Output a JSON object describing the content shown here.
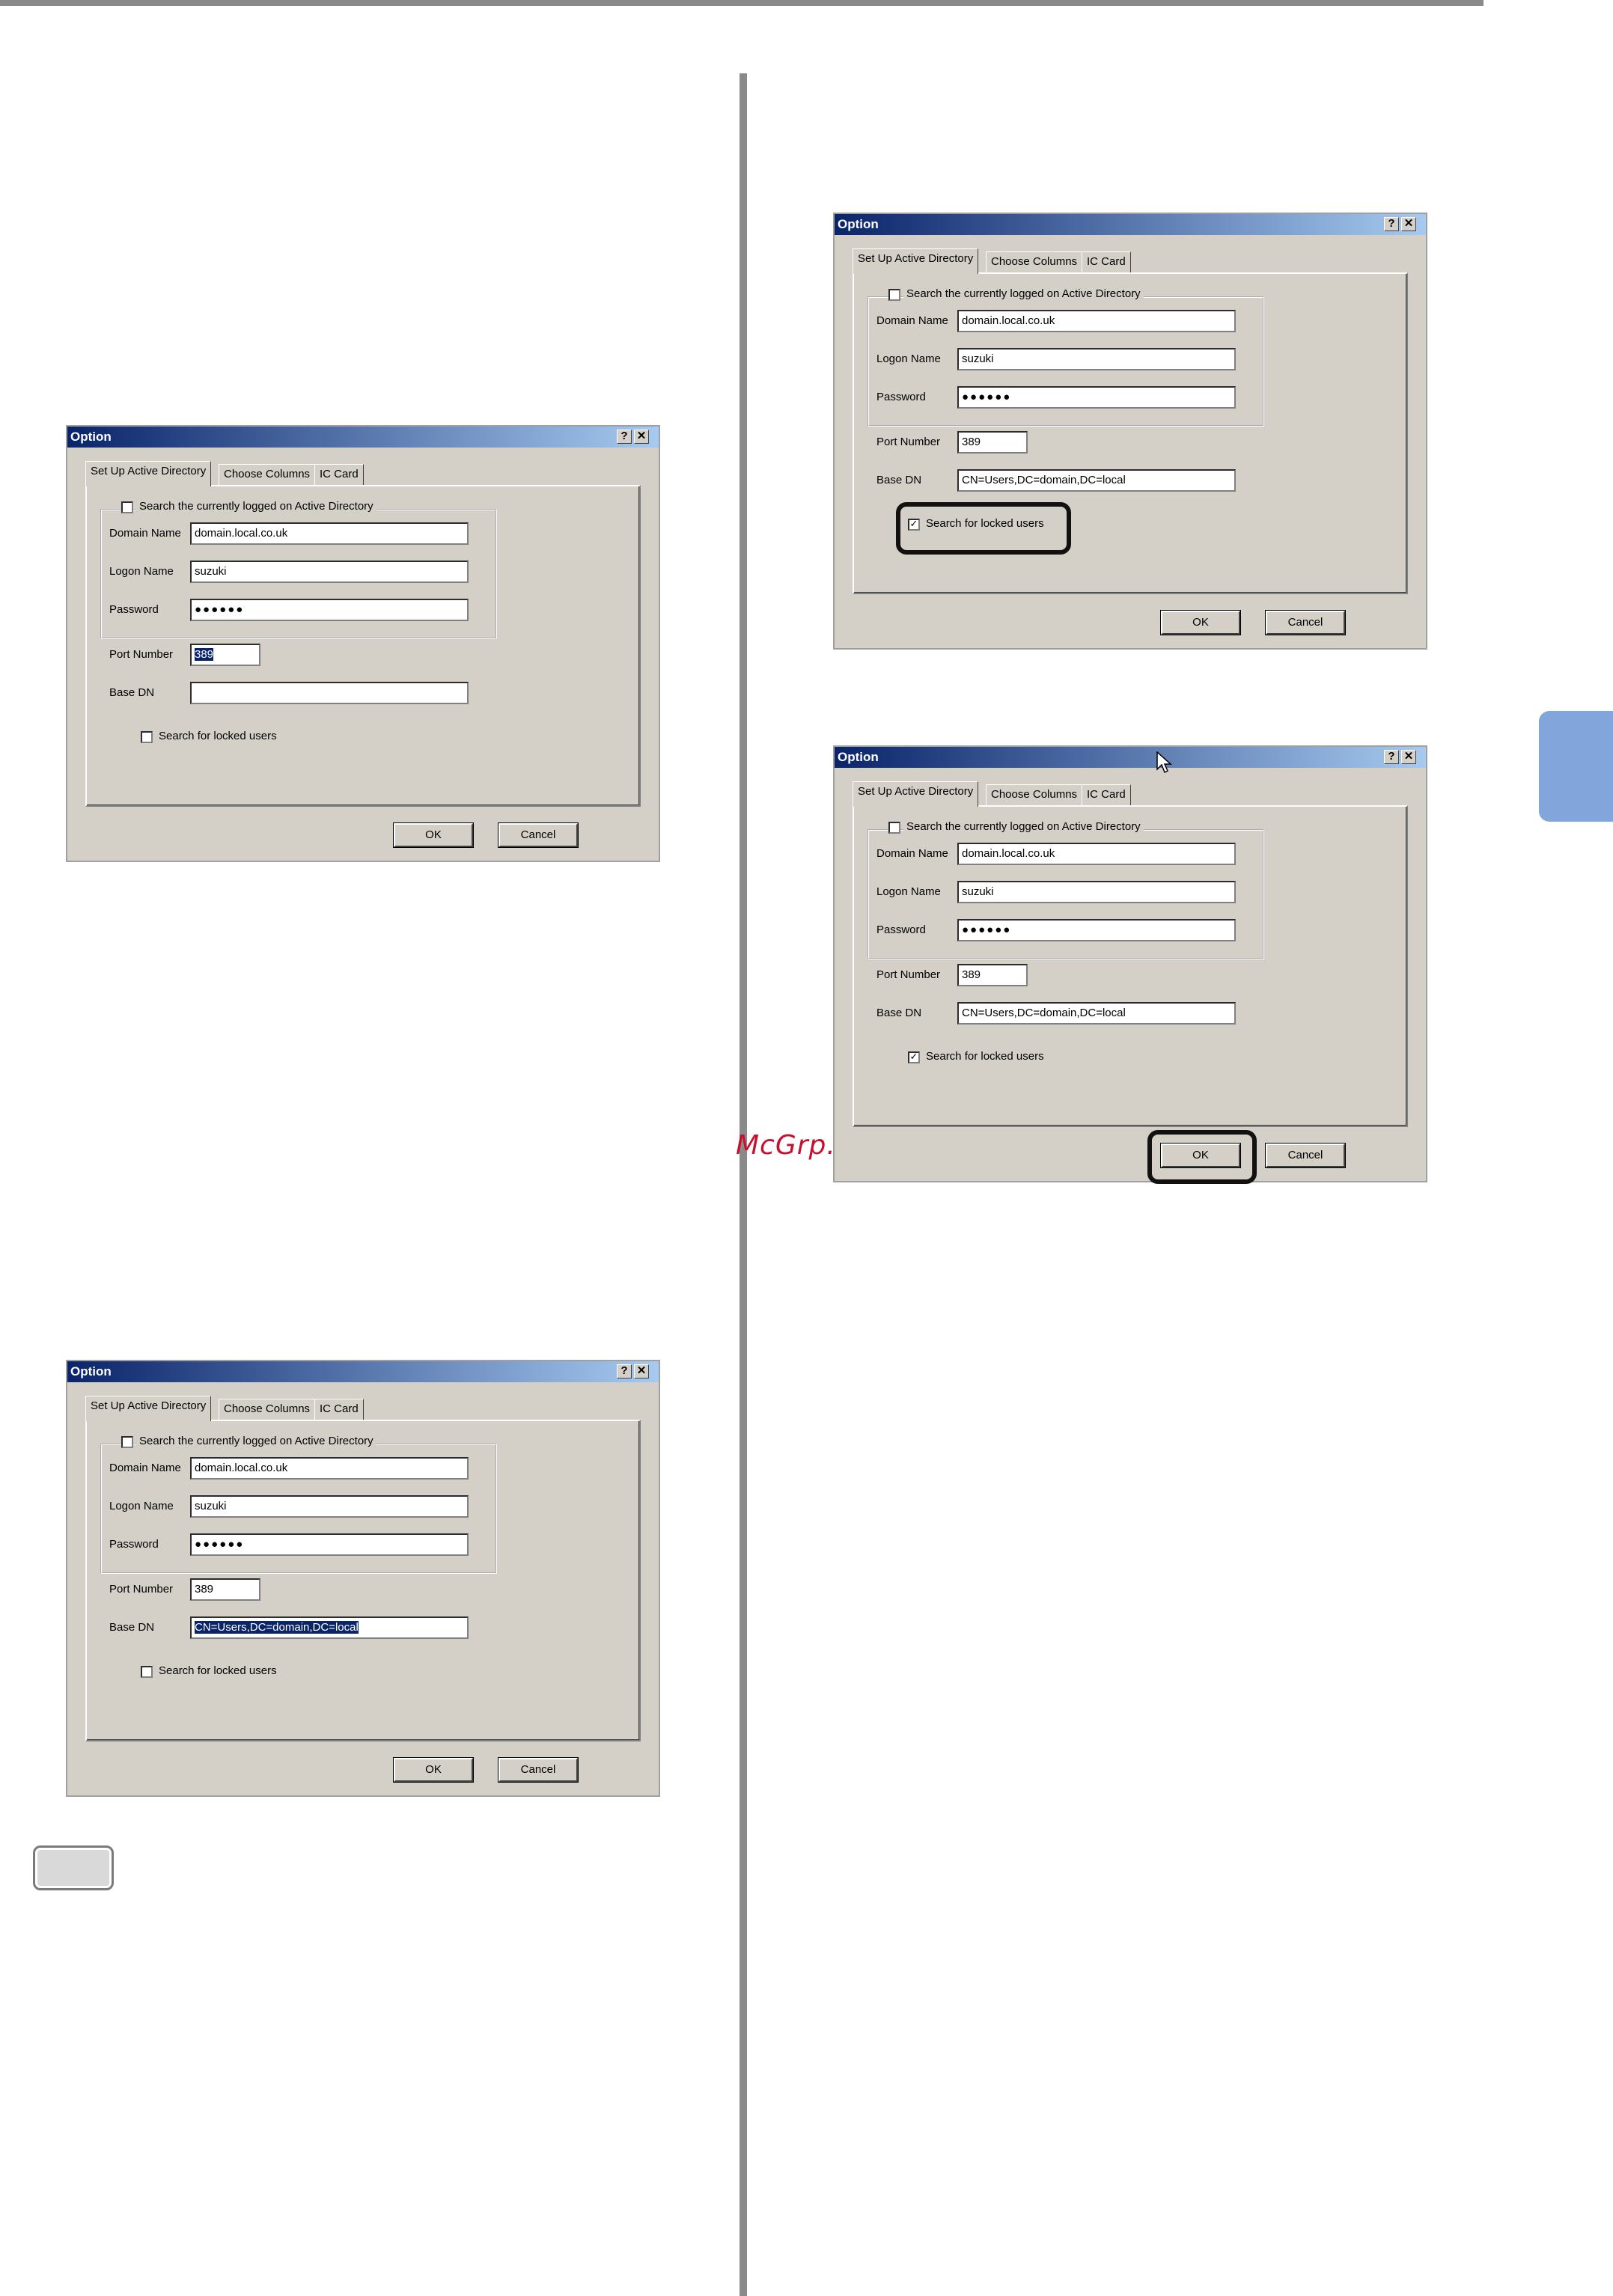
{
  "watermark": "McGrp.Ru",
  "dialog": {
    "title": "Option",
    "help_button": "?",
    "close_button": "✕",
    "tabs": [
      "Set Up Active Directory",
      "Choose Columns",
      "IC Card"
    ],
    "search_logged_on_label": "Search the currently logged on Active Directory",
    "domain_name_label": "Domain Name",
    "logon_name_label": "Logon Name",
    "password_label": "Password",
    "port_number_label": "Port Number",
    "base_dn_label": "Base DN",
    "search_locked_users_label": "Search for locked users",
    "ok_label": "OK",
    "cancel_label": "Cancel"
  },
  "dialogs": [
    {
      "domain_name": "domain.local.co.uk",
      "logon_name": "suzuki",
      "password": "●●●●●●",
      "port_number": "389",
      "base_dn": "",
      "locked_checked": ""
    },
    {
      "domain_name": "domain.local.co.uk",
      "logon_name": "suzuki",
      "password": "●●●●●●",
      "port_number": "389",
      "base_dn": "CN=Users,DC=domain,DC=local",
      "locked_checked": ""
    },
    {
      "domain_name": "domain.local.co.uk",
      "logon_name": "suzuki",
      "password": "●●●●●●",
      "port_number": "389",
      "base_dn": "CN=Users,DC=domain,DC=local",
      "locked_checked": "✓"
    },
    {
      "domain_name": "domain.local.co.uk",
      "logon_name": "suzuki",
      "password": "●●●●●●",
      "port_number": "389",
      "base_dn": "CN=Users,DC=domain,DC=local",
      "locked_checked": "✓"
    }
  ]
}
